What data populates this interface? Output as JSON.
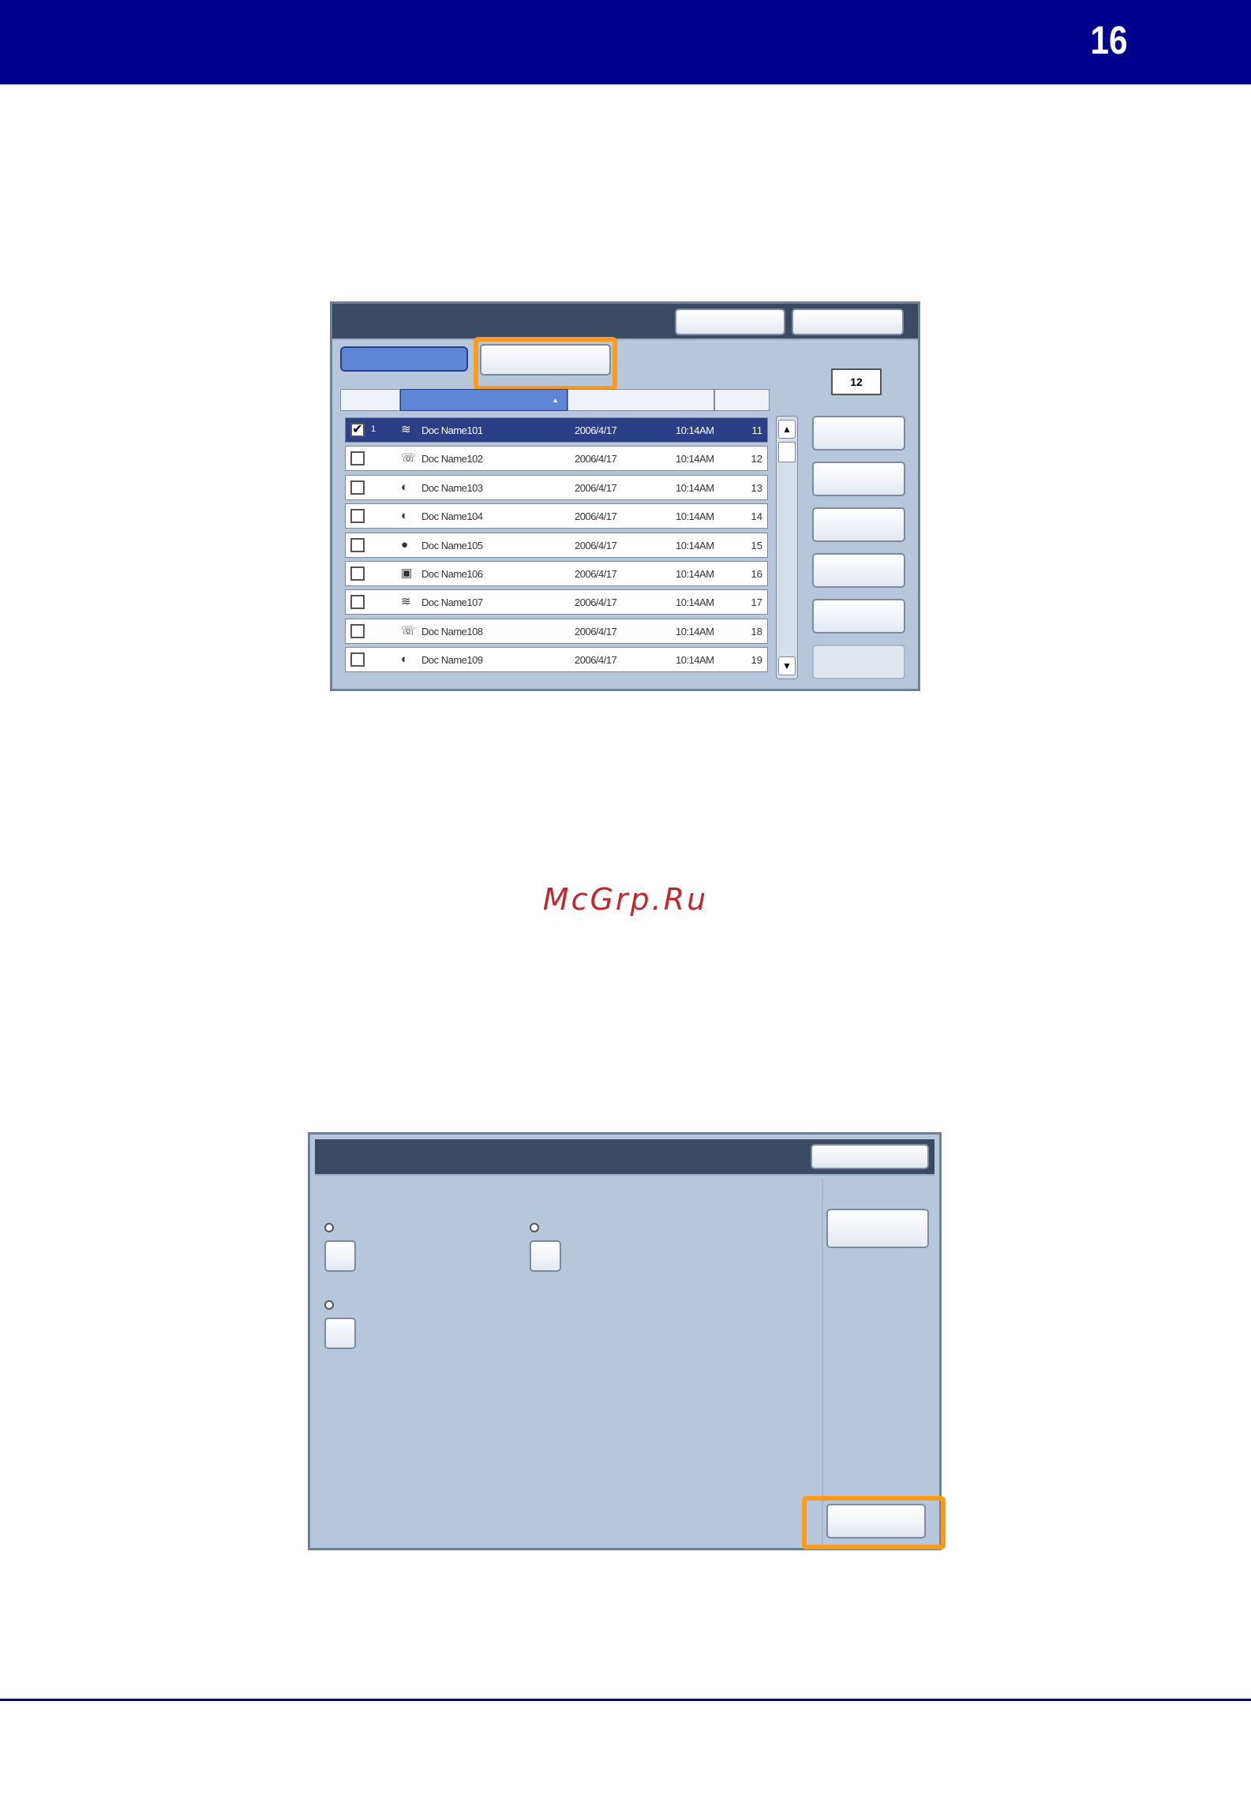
{
  "header": {
    "page_number": "16"
  },
  "screen1": {
    "counter": "12",
    "rows": [
      {
        "index": "1",
        "icon": "stapled-icon",
        "name": "Doc Name101",
        "date": "2006/4/17",
        "time": "10:14AM",
        "number": "11",
        "selected": true
      },
      {
        "index": "",
        "icon": "fax-icon",
        "name": "Doc Name102",
        "date": "2006/4/17",
        "time": "10:14AM",
        "number": "12",
        "selected": false
      },
      {
        "index": "",
        "icon": "scan-icon",
        "name": "Doc Name103",
        "date": "2006/4/17",
        "time": "10:14AM",
        "number": "13",
        "selected": false
      },
      {
        "index": "",
        "icon": "scan-icon",
        "name": "Doc Name104",
        "date": "2006/4/17",
        "time": "10:14AM",
        "number": "14",
        "selected": false
      },
      {
        "index": "",
        "icon": "globe-icon",
        "name": "Doc Name105",
        "date": "2006/4/17",
        "time": "10:14AM",
        "number": "15",
        "selected": false
      },
      {
        "index": "",
        "icon": "box-icon",
        "name": "Doc Name106",
        "date": "2006/4/17",
        "time": "10:14AM",
        "number": "16",
        "selected": false
      },
      {
        "index": "",
        "icon": "stapled-icon",
        "name": "Doc Name107",
        "date": "2006/4/17",
        "time": "10:14AM",
        "number": "17",
        "selected": false
      },
      {
        "index": "",
        "icon": "fax-icon",
        "name": "Doc Name108",
        "date": "2006/4/17",
        "time": "10:14AM",
        "number": "18",
        "selected": false
      },
      {
        "index": "",
        "icon": "scan-icon",
        "name": "Doc Name109",
        "date": "2006/4/17",
        "time": "10:14AM",
        "number": "19",
        "selected": false
      }
    ],
    "sort_indicator": "▲"
  },
  "watermark": "McGrp.Ru"
}
